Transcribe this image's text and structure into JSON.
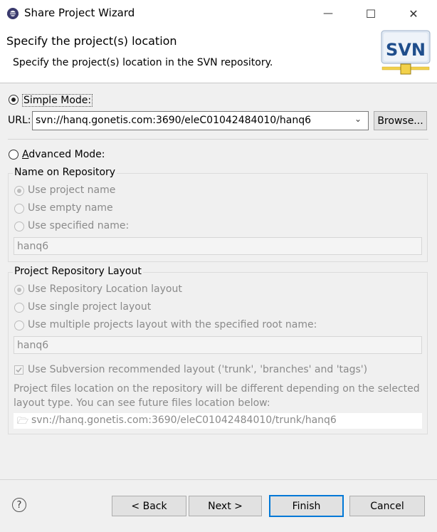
{
  "window": {
    "title": "Share Project Wizard",
    "minimize_symbol": "—",
    "maximize_symbol": "☐",
    "close_symbol": "✕"
  },
  "header": {
    "title": "Specify the project(s) location",
    "subtitle": "Specify the project(s) location in the SVN repository.",
    "logo_text": "SVN"
  },
  "simple_mode": {
    "label": "Simple Mode:",
    "selected": true,
    "url_label": "URL:",
    "url_value": "svn://hanq.gonetis.com:3690/eleC01042484010/hanq6",
    "browse_label": "Browse..."
  },
  "advanced_mode": {
    "label": "Advanced Mode:",
    "selected": false
  },
  "name_group": {
    "title": "Name on Repository",
    "option_project_name": "Use project name",
    "option_empty_name": "Use empty name",
    "option_specified_name": "Use specified name:",
    "name_value": "hanq6"
  },
  "layout_group": {
    "title": "Project Repository Layout",
    "option_repository_location": "Use Repository Location layout",
    "option_single_project": "Use single project layout",
    "option_multiple_projects": "Use multiple projects layout with the specified root name:",
    "root_name_value": "hanq6"
  },
  "subversion_layout": {
    "label": "Use Subversion recommended layout ('trunk', 'branches' and 'tags')",
    "checked": true
  },
  "info": {
    "text": "Project files location on the repository will be different depending on the selected layout type. You can see future files location below:",
    "future_location": "svn://hanq.gonetis.com:3690/eleC01042484010/trunk/hanq6"
  },
  "footer": {
    "help_symbol": "?",
    "back_label": "< Back",
    "next_label": "Next >",
    "finish_label": "Finish",
    "cancel_label": "Cancel"
  },
  "colors": {
    "accent": "#0078d7",
    "svn_logo_blue": "#1f4e8c",
    "svn_logo_yellow": "#f2d14b"
  }
}
